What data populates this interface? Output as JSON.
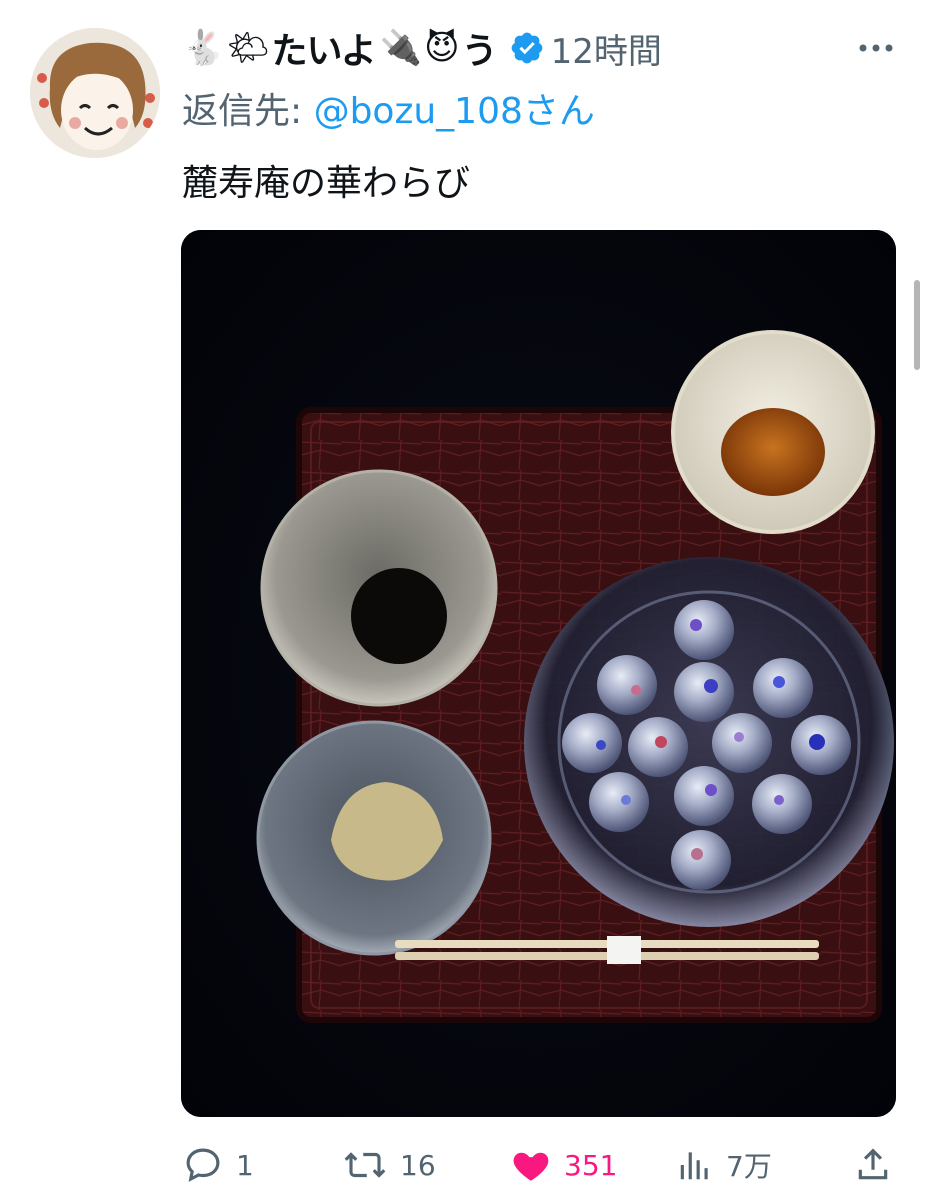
{
  "author": {
    "name_parts": [
      "たいよ",
      "う"
    ],
    "emojis": [
      "🐇",
      "🌤",
      "🔌",
      "😈"
    ],
    "verified": true,
    "time": "12時間"
  },
  "reply": {
    "prefix": "返信先: ",
    "handle": "@bozu_108さん"
  },
  "tweet": {
    "text": "麓寿庵の華わらび"
  },
  "actions": {
    "replies": "1",
    "retweets": "16",
    "likes": "351",
    "views": "7万"
  },
  "colors": {
    "accent": "#1d9bf0",
    "like": "#f91880",
    "muted": "#536471"
  }
}
